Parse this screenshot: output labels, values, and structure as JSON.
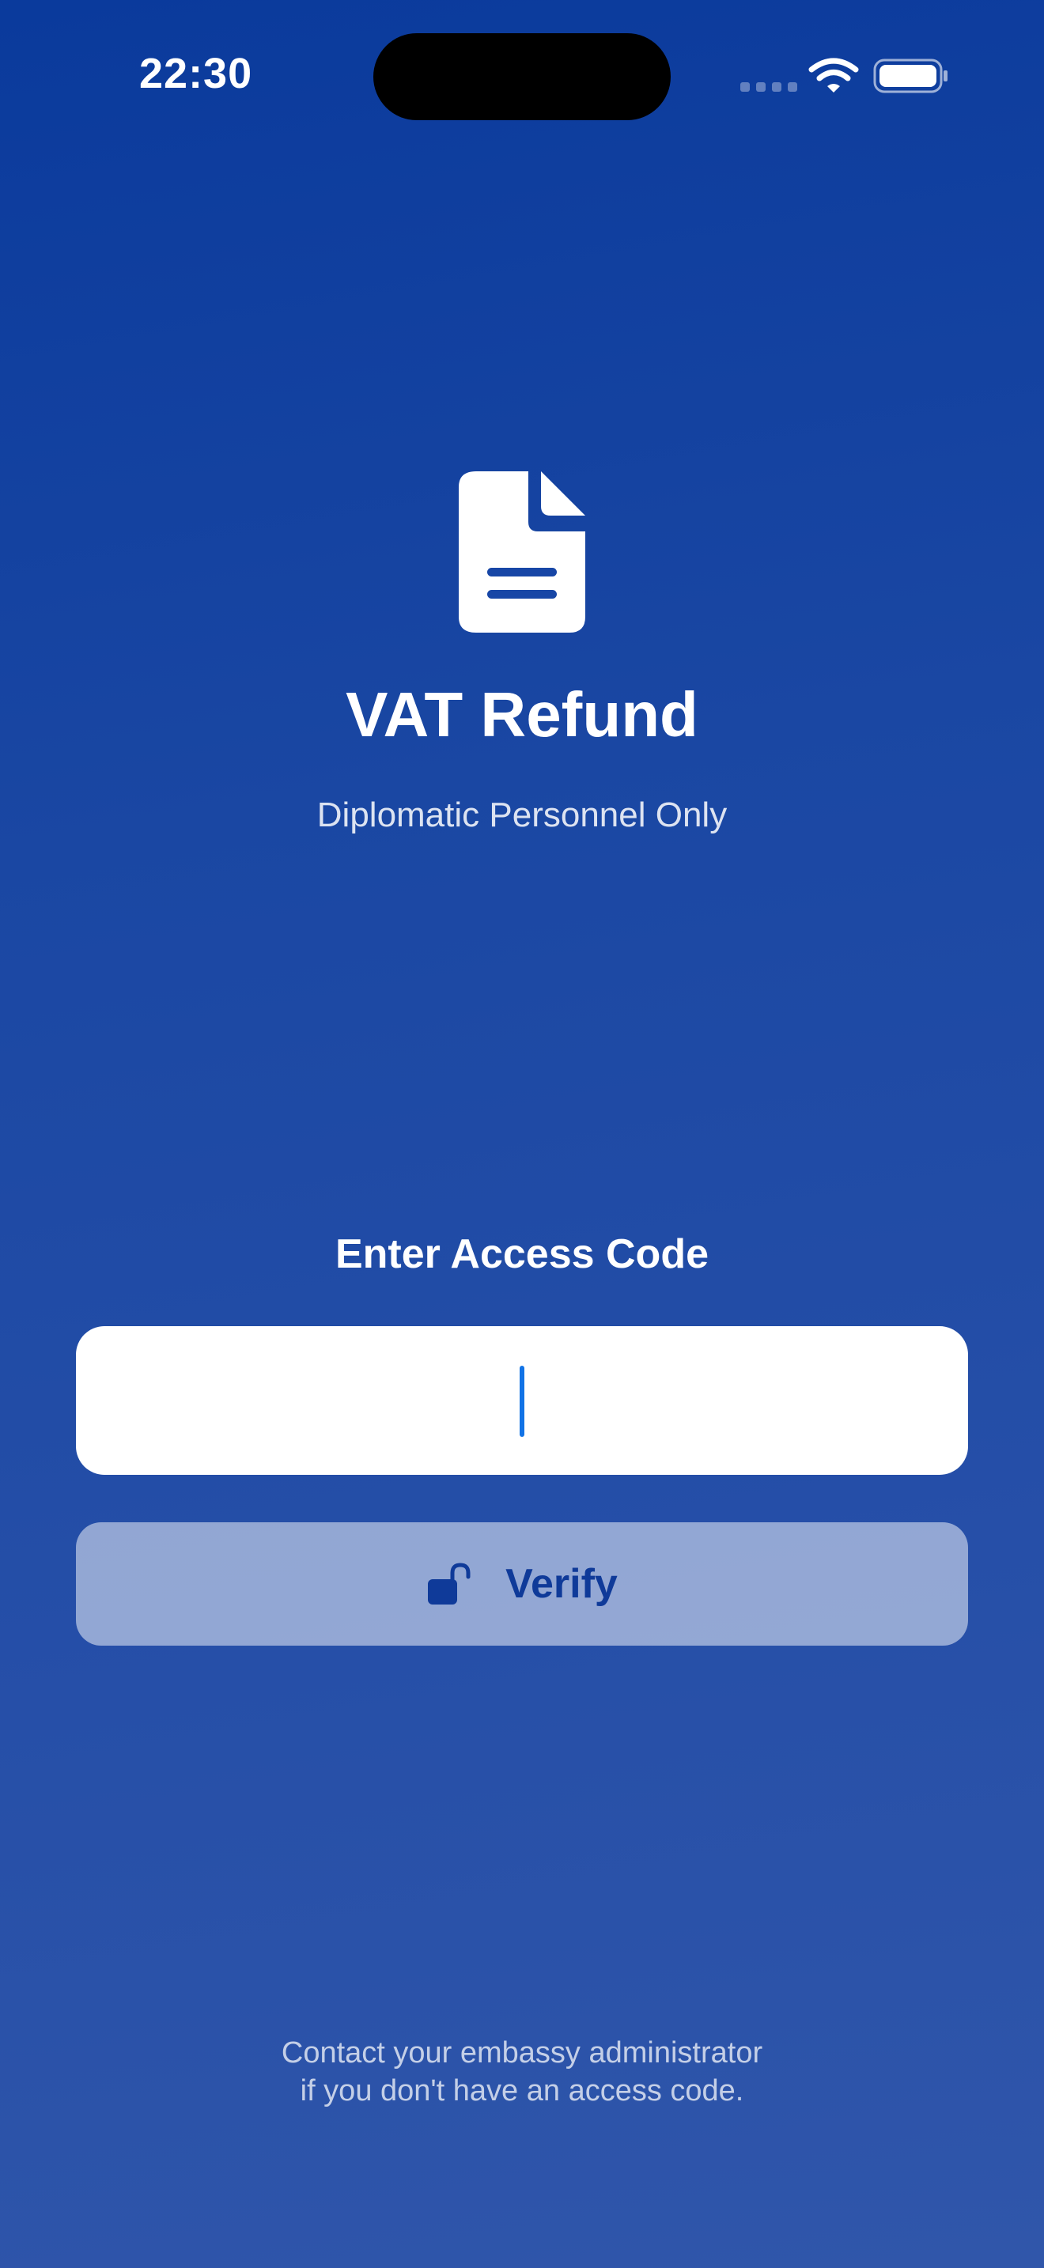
{
  "status_bar": {
    "time": "22:30"
  },
  "header": {
    "icon": "document-icon",
    "title": "VAT Refund",
    "subtitle": "Diplomatic Personnel Only"
  },
  "form": {
    "label": "Enter Access Code",
    "code_value": "",
    "verify_label": "Verify",
    "verify_icon": "lock-open-icon"
  },
  "footer": {
    "line1": "Contact your embassy administrator",
    "line2": "if you don't have an access code."
  },
  "colors": {
    "background_top": "#0a3a9c",
    "background_bottom": "#3056aa",
    "button_text": "#0f3a99",
    "caret": "#1273e6"
  }
}
